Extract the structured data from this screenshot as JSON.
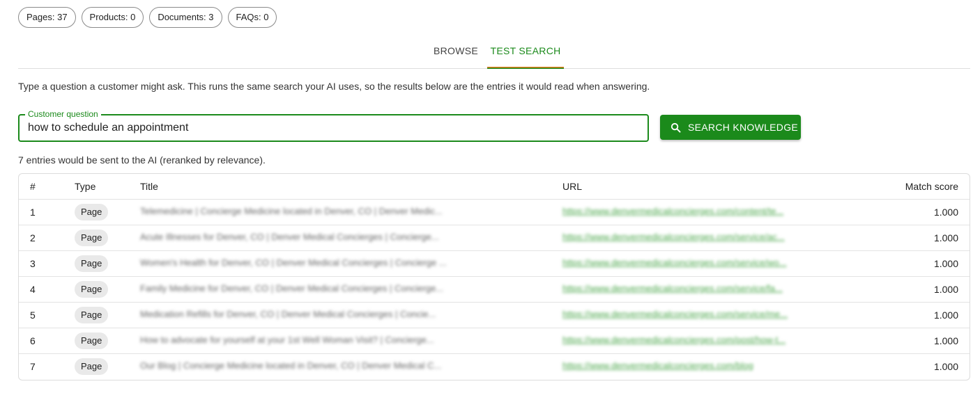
{
  "counts": {
    "pages": "Pages: 37",
    "products": "Products: 0",
    "documents": "Documents: 3",
    "faqs": "FAQs: 0"
  },
  "tabs": {
    "browse": "BROWSE",
    "test_search": "TEST SEARCH",
    "active": "test_search"
  },
  "description": "Type a question a customer might ask. This runs the same search your AI uses, so the results below are the entries it would read when answering.",
  "search": {
    "label": "Customer question",
    "value": "how to schedule an appointment",
    "button_label": "SEARCH KNOWLEDGE",
    "button_icon": "search-icon"
  },
  "result_summary": "7 entries would be sent to the AI (reranked by relevance).",
  "table": {
    "headers": {
      "num": "#",
      "type": "Type",
      "title": "Title",
      "url": "URL",
      "score": "Match score"
    },
    "rows": [
      {
        "num": "1",
        "type": "Page",
        "title": "Telemedicine | Concierge Medicine located in Denver, CO | Denver Medic...",
        "url": "https://www.denvermedicalconcierges.com/content/te...",
        "score": "1.000"
      },
      {
        "num": "2",
        "type": "Page",
        "title": "Acute Illnesses for Denver, CO | Denver Medical Concierges | Concierge...",
        "url": "https://www.denvermedicalconcierges.com/service/ac...",
        "score": "1.000"
      },
      {
        "num": "3",
        "type": "Page",
        "title": "Women's Health for Denver, CO | Denver Medical Concierges | Concierge ...",
        "url": "https://www.denvermedicalconcierges.com/service/wo...",
        "score": "1.000"
      },
      {
        "num": "4",
        "type": "Page",
        "title": "Family Medicine for Denver, CO | Denver Medical Concierges | Concierge...",
        "url": "https://www.denvermedicalconcierges.com/service/fa...",
        "score": "1.000"
      },
      {
        "num": "5",
        "type": "Page",
        "title": "Medication Refills for Denver, CO | Denver Medical Concierges | Concie...",
        "url": "https://www.denvermedicalconcierges.com/service/me...",
        "score": "1.000"
      },
      {
        "num": "6",
        "type": "Page",
        "title": "How to advocate for yourself at your 1st Well Woman Visit? | Concierge...",
        "url": "https://www.denvermedicalconcierges.com/post/how-t...",
        "score": "1.000"
      },
      {
        "num": "7",
        "type": "Page",
        "title": "Our Blog | Concierge Medicine located in Denver, CO | Denver Medical C...",
        "url": "https://www.denvermedicalconcierges.com/blog",
        "score": "1.000"
      }
    ]
  },
  "colors": {
    "accent": "#1b8a1b",
    "tab_underline_top": "#e07b1a",
    "link": "#4aa64a"
  }
}
